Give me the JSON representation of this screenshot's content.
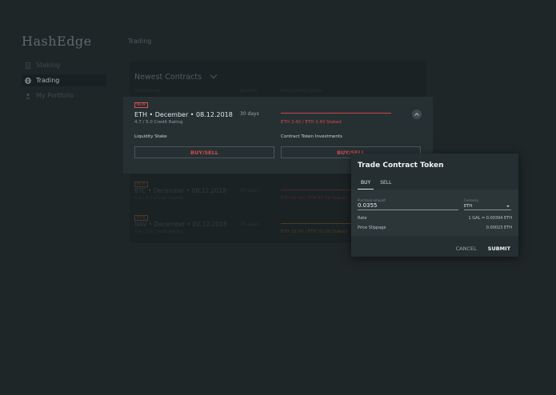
{
  "app": {
    "logo": "HashEdge"
  },
  "header": {
    "title": "Trading"
  },
  "sidebar": {
    "items": [
      {
        "label": "Staking",
        "icon": "document-icon",
        "active": false
      },
      {
        "label": "Trading",
        "icon": "globe-icon",
        "active": true
      },
      {
        "label": "My Portfolio",
        "icon": "person-icon",
        "active": false
      }
    ]
  },
  "contracts": {
    "title": "Newest Contracts",
    "columns": [
      "Contract Info",
      "Duration",
      "Pool Contract Stakes"
    ],
    "expanded": {
      "tag": "NEW",
      "name": "ETH • December • 08.12.2018",
      "rating": "4.7 / 5.0 Credit Rating",
      "duration": "30 days",
      "staked": "ETH 3.40 / ETH 3.40 Staked",
      "liquidity_label": "Liquidity Stake",
      "investments_label": "Contract Token Investments",
      "buy_sell_1": "BUY/SELL",
      "buy_sell_2": "BUY/SELL"
    },
    "rows": [
      {
        "tag": "NEW",
        "name": "BTC • December • 08.12.2018",
        "rating": "3.4 / 5.0 Credit Rating",
        "duration": "60 days",
        "staked": "ETH 42.00 / ETH 42.00 Staked"
      },
      {
        "tag": "NEW",
        "name": "NAV • December • 02.12.2018",
        "rating": "3.4 / 5.0 Credit Rating",
        "duration": "30 days",
        "staked": "ETH 32.00 / ETH 32.00 Staked"
      }
    ]
  },
  "modal": {
    "title": "Trade Contract Token",
    "tab_buy": "BUY",
    "tab_sell": "SELL",
    "amount_label": "Purchase amount",
    "amount_value": "0.0355",
    "currency_label": "Currency",
    "currency_value": "ETH",
    "rate_label": "Rate",
    "rate_value": "1 GAL = 0.00394 ETH",
    "slippage_label": "Price Slippage",
    "slippage_value": "0.00023 ETH",
    "cancel": "CANCEL",
    "submit": "SUBMIT"
  },
  "colors": {
    "accent_red": "#d14b4b",
    "accent_orange": "#c98a2a",
    "background": "#1f2628"
  }
}
